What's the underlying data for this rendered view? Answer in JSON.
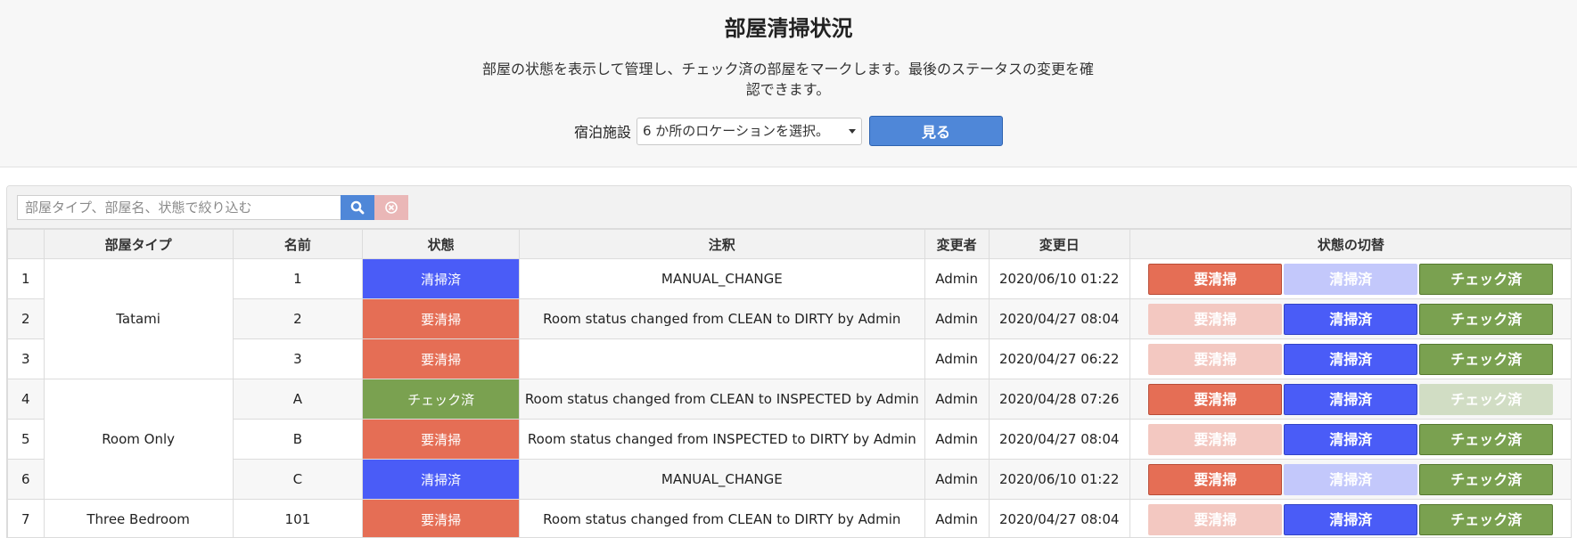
{
  "header": {
    "title": "部屋清掃状況",
    "description": "部屋の状態を表示して管理し、チェック済の部屋をマークします。最後のステータスの変更を確認できます。",
    "filter_label": "宿泊施設",
    "select_value": "6 か所のロケーションを選択。",
    "view_button": "見る"
  },
  "search": {
    "placeholder": "部屋タイプ、部屋名、状態で絞り込む"
  },
  "table": {
    "columns": [
      "",
      "部屋タイプ",
      "名前",
      "状態",
      "注釈",
      "変更者",
      "変更日",
      "状態の切替"
    ],
    "toggle_labels": {
      "dirty": "要清掃",
      "clean": "清掃済",
      "inspected": "チェック済"
    },
    "groups": [
      {
        "room_type": "Tatami",
        "rows": [
          {
            "no": "1",
            "name": "1",
            "status": "清掃済",
            "status_key": "clean",
            "note": "MANUAL_CHANGE",
            "by": "Admin",
            "date": "2020/06/10 01:22",
            "disabled": "clean"
          },
          {
            "no": "2",
            "name": "2",
            "status": "要清掃",
            "status_key": "dirty",
            "note": "Room status changed from CLEAN to DIRTY by Admin",
            "by": "Admin",
            "date": "2020/04/27 08:04",
            "disabled": "dirty"
          },
          {
            "no": "3",
            "name": "3",
            "status": "要清掃",
            "status_key": "dirty",
            "note": "",
            "by": "Admin",
            "date": "2020/04/27 06:22",
            "disabled": "dirty"
          }
        ]
      },
      {
        "room_type": "Room Only",
        "rows": [
          {
            "no": "4",
            "name": "A",
            "status": "チェック済",
            "status_key": "inspected",
            "note": "Room status changed from CLEAN to INSPECTED by Admin",
            "by": "Admin",
            "date": "2020/04/28 07:26",
            "disabled": "inspected"
          },
          {
            "no": "5",
            "name": "B",
            "status": "要清掃",
            "status_key": "dirty",
            "note": "Room status changed from INSPECTED to DIRTY by Admin",
            "by": "Admin",
            "date": "2020/04/27 08:04",
            "disabled": "dirty"
          },
          {
            "no": "6",
            "name": "C",
            "status": "清掃済",
            "status_key": "clean",
            "note": "MANUAL_CHANGE",
            "by": "Admin",
            "date": "2020/06/10 01:22",
            "disabled": "clean"
          }
        ]
      },
      {
        "room_type": "Three Bedroom",
        "rows": [
          {
            "no": "7",
            "name": "101",
            "status": "要清掃",
            "status_key": "dirty",
            "note": "Room status changed from CLEAN to DIRTY by Admin",
            "by": "Admin",
            "date": "2020/04/27 08:04",
            "disabled": "dirty"
          }
        ]
      }
    ]
  },
  "colors": {
    "clean": "#4a5cf7",
    "dirty": "#e56e55",
    "inspected": "#7aa150",
    "primary": "#4f87d8"
  },
  "icons": {
    "search": "search-icon",
    "clear": "clear-icon",
    "dropdown": "caret-down-icon"
  }
}
